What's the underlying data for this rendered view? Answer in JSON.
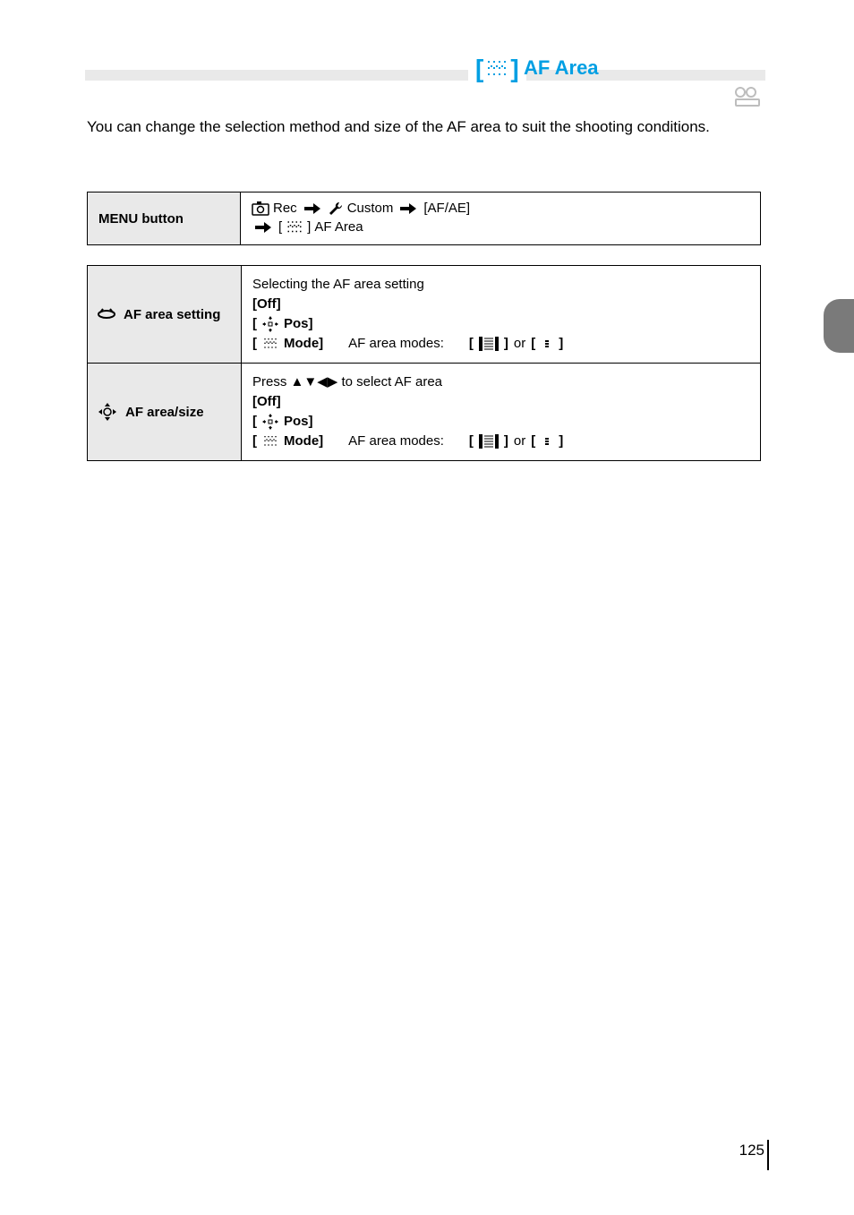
{
  "section": {
    "title": "AF Area"
  },
  "intro": "You can change the selection method and size of the AF area to suit the shooting conditions.",
  "nav": {
    "label": "MENU button",
    "rec_label": "Rec",
    "custom_label": "Custom",
    "af_area_label": "AF Area"
  },
  "row1": {
    "label": "AF area setting",
    "topic": "Selecting the AF area setting",
    "off": "[Off]",
    "pos": "Pos]",
    "mode": "Mode]",
    "modes_label": "AF area modes:",
    "or": " or"
  },
  "row2": {
    "label": "AF area/size",
    "topic": "Press ▲▼◀▶ to select AF area",
    "off": "[Off]",
    "pos": "Pos]",
    "mode": "Mode]",
    "modes_label": "AF area modes:",
    "or": " or"
  },
  "page_number": "125"
}
